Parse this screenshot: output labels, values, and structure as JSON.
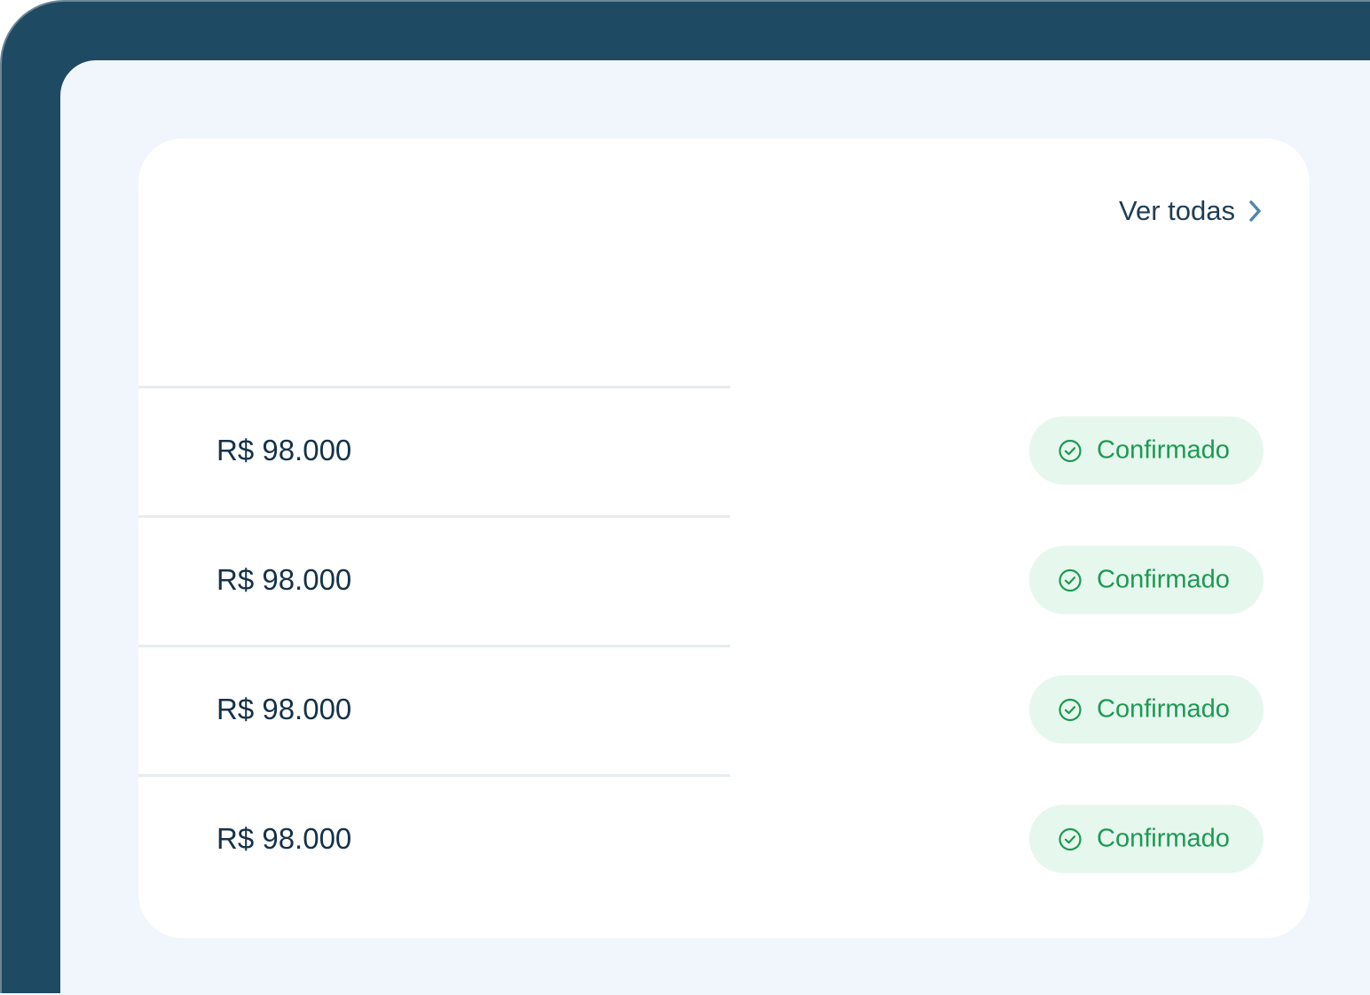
{
  "header": {
    "view_all_label": "Ver todas",
    "view_all_icon": "chevron-right-icon"
  },
  "rows": [
    {
      "amount": "R$ 98.000",
      "status": "Confirmado",
      "status_icon": "check-circle-icon"
    },
    {
      "amount": "R$ 98.000",
      "status": "Confirmado",
      "status_icon": "check-circle-icon"
    },
    {
      "amount": "R$ 98.000",
      "status": "Confirmado",
      "status_icon": "check-circle-icon"
    },
    {
      "amount": "R$ 98.000",
      "status": "Confirmado",
      "status_icon": "check-circle-icon"
    }
  ],
  "colors": {
    "frame": "#1f4a63",
    "screen_bg": "#f1f6fc",
    "card_bg": "#ffffff",
    "text_primary": "#16324a",
    "link_text": "#1f3d55",
    "chevron": "#4f86ad",
    "status_green": "#1c9a52",
    "status_bg": "#e6f7ee",
    "divider": "#e8ecef"
  }
}
